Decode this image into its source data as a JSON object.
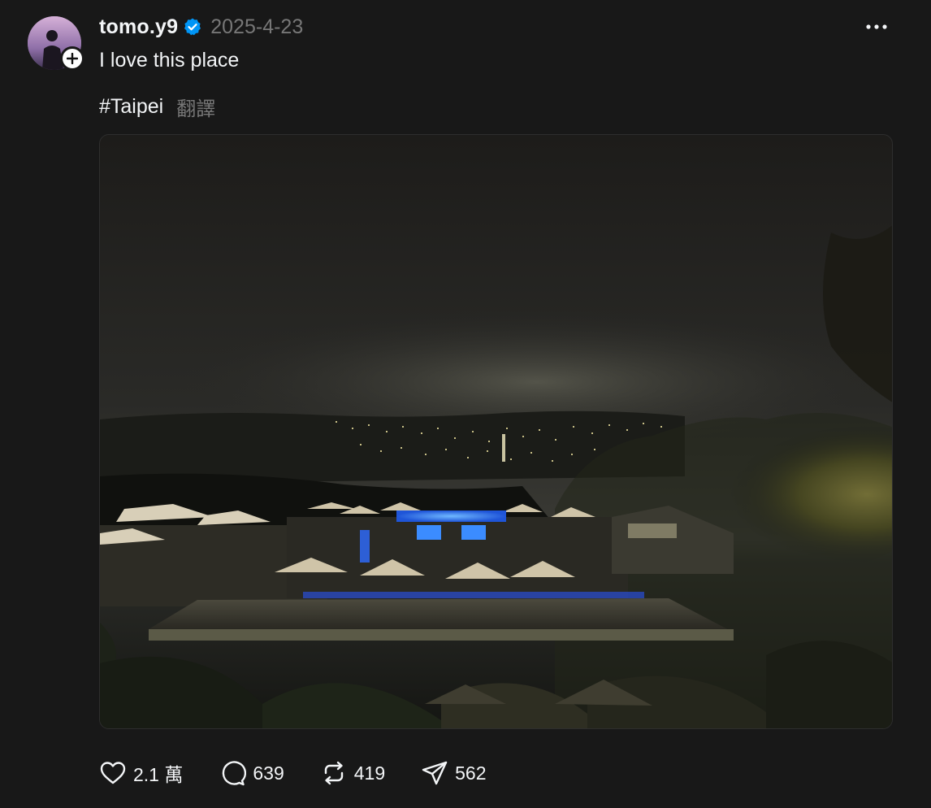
{
  "post": {
    "username": "tomo.y9",
    "verified": true,
    "date": "2025-4-23",
    "caption": "I love this place",
    "hashtag": "#Taipei",
    "translate_label": "翻譯",
    "image_alt": "Night view over Taipei from a hillside terrace with umbrellas and a lit pool",
    "actions": {
      "likes": "2.1 萬",
      "comments": "639",
      "reposts": "419",
      "shares": "562"
    }
  },
  "icons": {
    "verified": "verified-badge-icon",
    "more": "more-horizontal-icon",
    "follow": "plus-icon",
    "like": "heart-icon",
    "comment": "comment-bubble-icon",
    "repost": "repost-icon",
    "share": "send-icon"
  },
  "colors": {
    "background": "#181818",
    "text_primary": "#f3f5f7",
    "text_secondary": "#777777",
    "verified_blue": "#0095f6"
  }
}
